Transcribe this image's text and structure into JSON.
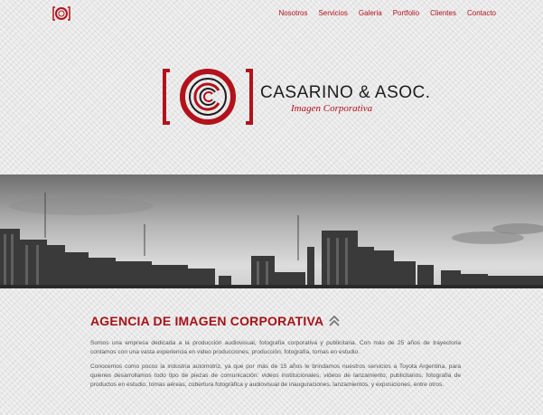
{
  "nav": {
    "items": [
      "Nosotros",
      "Servicios",
      "Galeria",
      "Portfolio",
      "Clientes",
      "Contacto"
    ]
  },
  "brand": {
    "name": "CASARINO & ASOC.",
    "tagline": "Imagen Corporativa"
  },
  "icons": {
    "mini_logo": "camera-lens-logo-icon",
    "main_logo": "camera-lens-logo-icon",
    "scroll_up": "double-chevron-up-icon"
  },
  "colors": {
    "accent": "#b3121b",
    "heading": "#a51217",
    "text": "#555555"
  },
  "content": {
    "heading": "AGENCIA DE IMAGEN CORPORATIVA",
    "paragraphs": [
      "Somos una empresa dedicada a la producción audiovisual, fotografía corporativa y publicitaria. Con más de 25 años de trayectoria contamos con una vasta experiencia en video producciones, producción, fotografía, tomas en estudio.",
      "Conocemos como pocos la industria automotriz, ya que por más de 15 años le brindamos nuestros servicios a Toyota Argentina, para quienes desarrollamos todo tipo de piezas de comunicación: videos institucionales, videos de lanzamiento, publicitarios, fotografía de productos en estudio, tomas aéreas, cobertura fotográfica y audiovisual de inauguraciones, lanzamientos, y exposiciones, entre otros."
    ]
  }
}
